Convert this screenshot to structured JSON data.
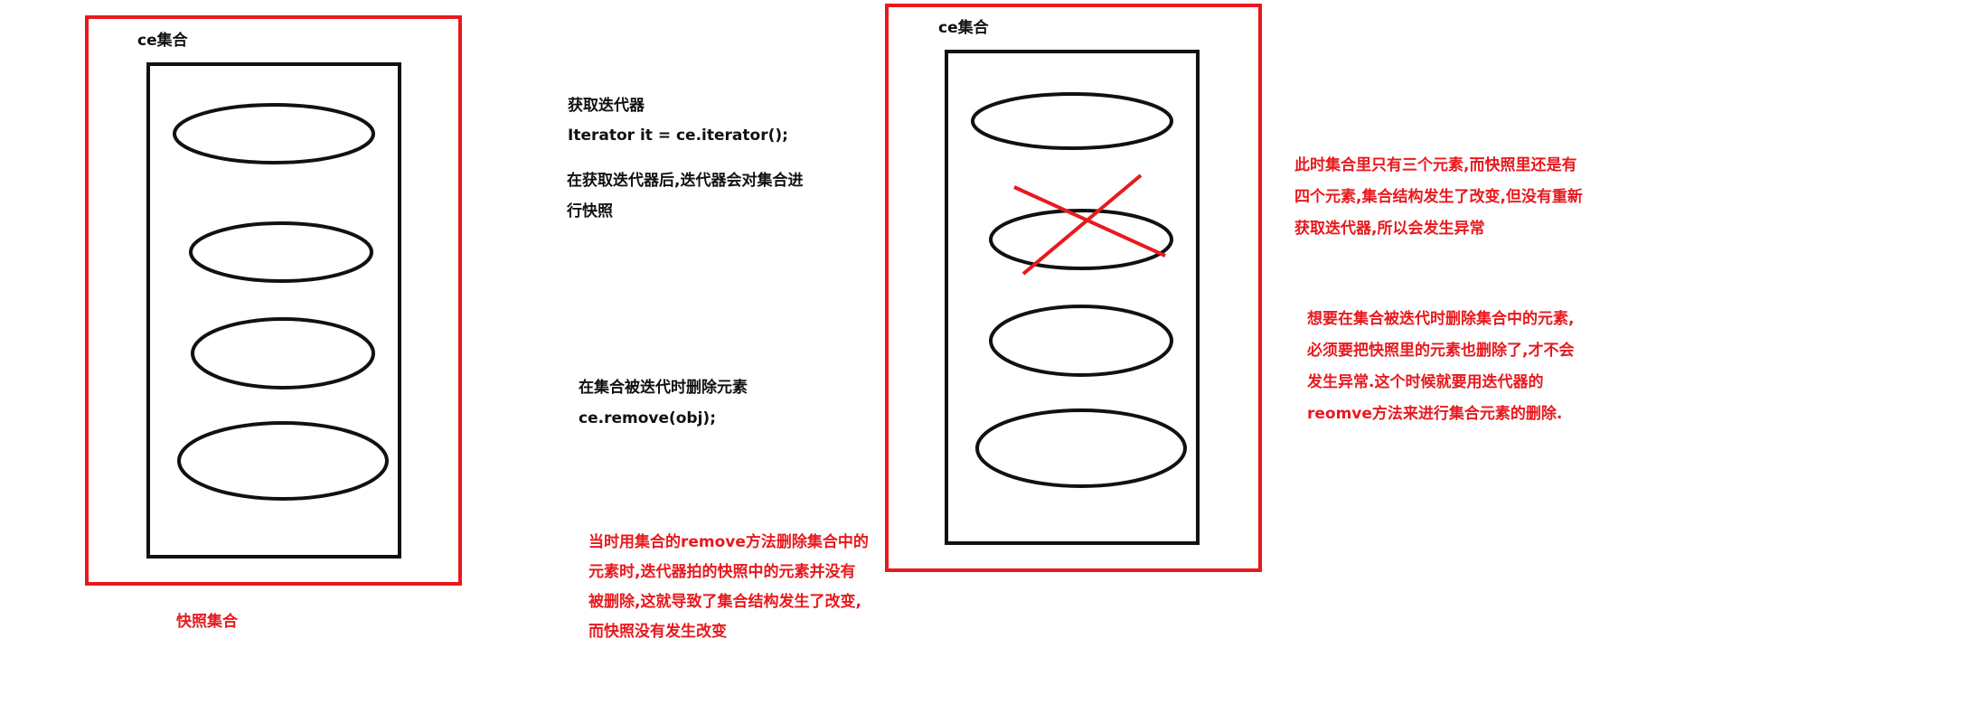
{
  "colors": {
    "red": "#e8191e",
    "black": "#111111"
  },
  "left_panel": {
    "title": "ce集合",
    "caption": "快照集合"
  },
  "right_panel": {
    "title": "ce集合"
  },
  "notes": {
    "get_iterator": {
      "heading": "获取迭代器",
      "code": "Iterator it  = ce.iterator();"
    },
    "snapshot": {
      "lines": [
        "在获取迭代器后,迭代器会对集合进",
        "行快照"
      ]
    },
    "remove_during_iteration": {
      "heading": "在集合被迭代时删除元素",
      "code": "ce.remove(obj);"
    },
    "red_explanation_1": {
      "lines": [
        "当时用集合的remove方法删除集合中的",
        "元素时,迭代器拍的快照中的元素并没有",
        "被删除,这就导致了集合结构发生了改变,",
        "而快照没有发生改变"
      ]
    },
    "red_explanation_2": {
      "lines": [
        "此时集合里只有三个元素,而快照里还是有",
        "四个元素,集合结构发生了改变,但没有重新",
        "获取迭代器,所以会发生异常"
      ]
    },
    "red_explanation_3": {
      "lines": [
        "想要在集合被迭代时删除集合中的元素,",
        "必须要把快照里的元素也删除了,才不会",
        "发生异常.这个时候就要用迭代器的",
        "reomve方法来进行集合元素的删除."
      ]
    }
  }
}
